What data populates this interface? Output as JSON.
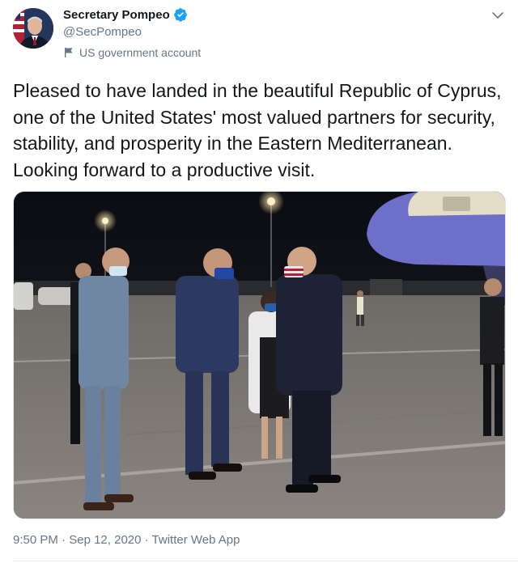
{
  "author": {
    "display_name": "Secretary Pompeo",
    "handle": "@SecPompeo",
    "label": "US government account",
    "verified": true
  },
  "tweet": {
    "text": "Pleased to have landed in the beautiful Republic of Cyprus, one of the United States' most valued partners for security, stability, and prosperity in the Eastern Mediterranean. Looking forward to a productive visit.",
    "time": "9:50 PM",
    "separator": "·",
    "date": "Sep 12, 2020",
    "source": "Twitter Web App"
  },
  "icons": {
    "verified": "verified-badge-icon",
    "gov": "flag-icon",
    "menu": "chevron-down-icon"
  },
  "colors": {
    "accent": "#1da1f2",
    "secondary_text": "#657786",
    "primary_text": "#14171a"
  }
}
